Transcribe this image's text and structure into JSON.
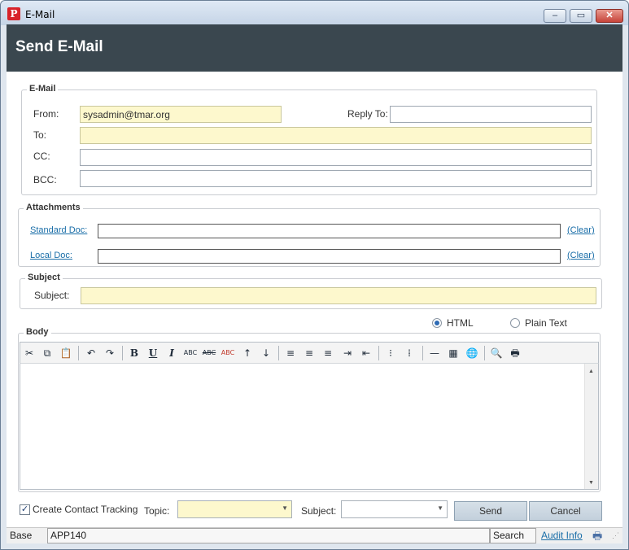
{
  "window": {
    "title": "E-Mail",
    "icon": "app-logo-icon",
    "controls": {
      "minimize": "–",
      "maximize": "▭",
      "close": "✕"
    }
  },
  "header": {
    "title": "Send E-Mail"
  },
  "email": {
    "legend": "E-Mail",
    "from_label": "From:",
    "from_value": "sysadmin@tmar.org",
    "reply_to_label": "Reply To:",
    "reply_to_value": "",
    "to_label": "To:",
    "to_value": "",
    "cc_label": "CC:",
    "cc_value": "",
    "bcc_label": "BCC:",
    "bcc_value": ""
  },
  "attachments": {
    "legend": "Attachments",
    "standard_doc_label": "Standard Doc:",
    "standard_doc_value": "",
    "local_doc_label": "Local Doc:",
    "local_doc_value": "",
    "clear_label": "(Clear)"
  },
  "subject": {
    "legend": "Subject",
    "label": "Subject:",
    "value": ""
  },
  "body": {
    "legend": "Body",
    "format_options": [
      {
        "label": "HTML",
        "selected": true
      },
      {
        "label": "Plain Text",
        "selected": false
      }
    ],
    "toolbar": {
      "cut": "✂",
      "copy": "⧉",
      "paste": "📋",
      "undo": "↶",
      "redo": "↷",
      "bold": "B",
      "underline": "U",
      "italic": "I",
      "spell1": "ABC",
      "spell2": "ABC",
      "spell3": "ABC",
      "sort_asc": "↑",
      "sort_desc": "↓",
      "align_left": "≡",
      "align_center": "≡",
      "align_right": "≡",
      "indent": "⇥",
      "outdent": "⇤",
      "bullets": "⁝",
      "numbering": "⁞",
      "hr": "—",
      "table": "▦",
      "link": "🌐",
      "find": "🔍",
      "print": "🖶"
    },
    "text": ""
  },
  "footer": {
    "contact_tracking_label": "Create Contact Tracking",
    "contact_tracking_checked": true,
    "topic_label": "Topic:",
    "topic_value": "",
    "subject_label": "Subject:",
    "subject_value": "",
    "send_label": "Send",
    "cancel_label": "Cancel"
  },
  "statusbar": {
    "base_label": "Base",
    "app_code": "APP140",
    "search_label": "Search",
    "audit_label": "Audit Info"
  },
  "colors": {
    "header_bg": "#3a474f",
    "required_field": "#fdf8cd",
    "link": "#1a6ea8"
  }
}
